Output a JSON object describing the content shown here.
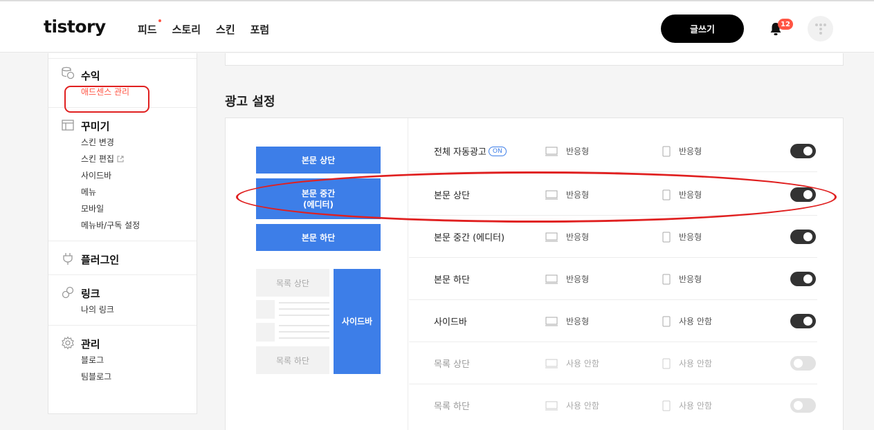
{
  "header": {
    "logo": "tistory",
    "nav": [
      "피드",
      "스토리",
      "스킨",
      "포럼"
    ],
    "write_label": "글쓰기",
    "notification_count": "12"
  },
  "sidebar": {
    "sections": [
      {
        "title": "수익",
        "icon": "coins-icon",
        "items": [
          "애드센스 관리"
        ]
      },
      {
        "title": "꾸미기",
        "icon": "layout-icon",
        "items": [
          "스킨 변경",
          "스킨 편집",
          "사이드바",
          "메뉴",
          "모바일",
          "메뉴바/구독 설정"
        ]
      },
      {
        "title": "플러그인",
        "icon": "plug-icon",
        "items": []
      },
      {
        "title": "링크",
        "icon": "link-icon",
        "items": [
          "나의 링크"
        ]
      },
      {
        "title": "관리",
        "icon": "gear-icon",
        "items": [
          "블로그",
          "팀블로그"
        ]
      }
    ]
  },
  "main": {
    "section_title": "광고 설정",
    "preview": {
      "body_top": "본문 상단",
      "body_middle_1": "본문 중간",
      "body_middle_2": "(에디터)",
      "body_bottom": "본문 하단",
      "list_top": "목록 상단",
      "list_bottom": "목록 하단",
      "sidebar": "사이드바"
    },
    "on_badge": "ON",
    "rows": [
      {
        "label": "전체 자동광고",
        "desktop": "반응형",
        "mobile": "반응형",
        "enabled": true
      },
      {
        "label": "본문 상단",
        "desktop": "반응형",
        "mobile": "반응형",
        "enabled": true
      },
      {
        "label": "본문 중간 (에디터)",
        "desktop": "반응형",
        "mobile": "반응형",
        "enabled": true
      },
      {
        "label": "본문 하단",
        "desktop": "반응형",
        "mobile": "반응형",
        "enabled": true
      },
      {
        "label": "사이드바",
        "desktop": "반응형",
        "mobile": "사용 안함",
        "enabled": true
      },
      {
        "label": "목록 상단",
        "desktop": "사용 안함",
        "mobile": "사용 안함",
        "enabled": false
      },
      {
        "label": "목록 하단",
        "desktop": "사용 안함",
        "mobile": "사용 안함",
        "enabled": false
      }
    ]
  },
  "colors": {
    "accent_blue": "#3d7ee8",
    "accent_red": "#ff5544",
    "annotation_red": "#e02020"
  }
}
